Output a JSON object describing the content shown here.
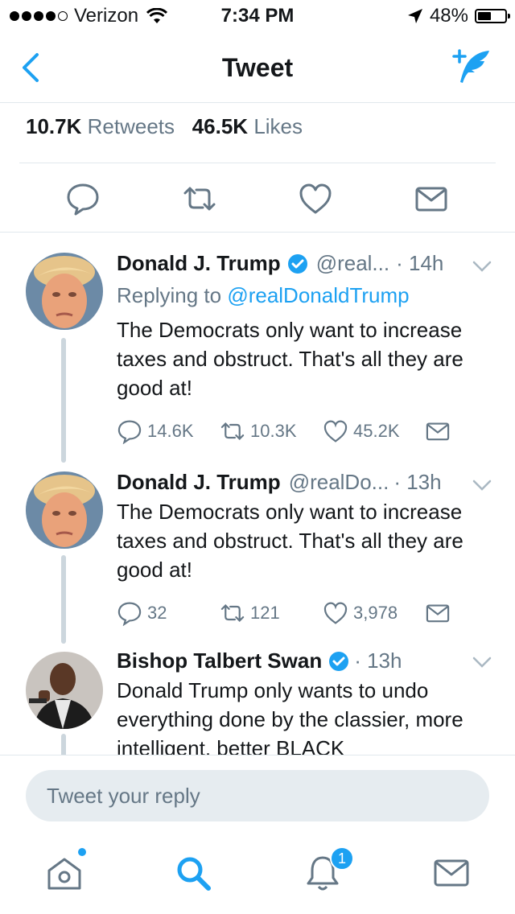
{
  "status_bar": {
    "carrier": "Verizon",
    "time": "7:34 PM",
    "battery": "48%"
  },
  "nav": {
    "title": "Tweet"
  },
  "stats": {
    "retweets_count": "10.7K",
    "retweets_label": "Retweets",
    "likes_count": "46.5K",
    "likes_label": "Likes"
  },
  "tweets": [
    {
      "name": "Donald J. Trump",
      "handle": "@real...",
      "time": "· 14h",
      "replying_prefix": "Replying to",
      "replying_to": "@realDonaldTrump",
      "text": "The Democrats only want to increase taxes and obstruct. That's all they are good at!",
      "replies": "14.6K",
      "retweets": "10.3K",
      "likes": "45.2K"
    },
    {
      "name": "Donald J. Trump",
      "handle": "@realDo...",
      "time": "· 13h",
      "text": "The Democrats only want to increase taxes and obstruct. That's all they are good at!",
      "replies": "32",
      "retweets": "121",
      "likes": "3,978"
    },
    {
      "name": "Bishop Talbert Swan",
      "time": "· 13h",
      "text": "Donald Trump only wants to undo everything done by the classier, more intelligent, better BLACK"
    }
  ],
  "reply": {
    "placeholder": "Tweet your reply"
  },
  "tabbar": {
    "notifications_badge": "1"
  },
  "colors": {
    "accent": "#1da1f2",
    "secondary_text": "#657786",
    "divider": "#e1e8ed"
  }
}
